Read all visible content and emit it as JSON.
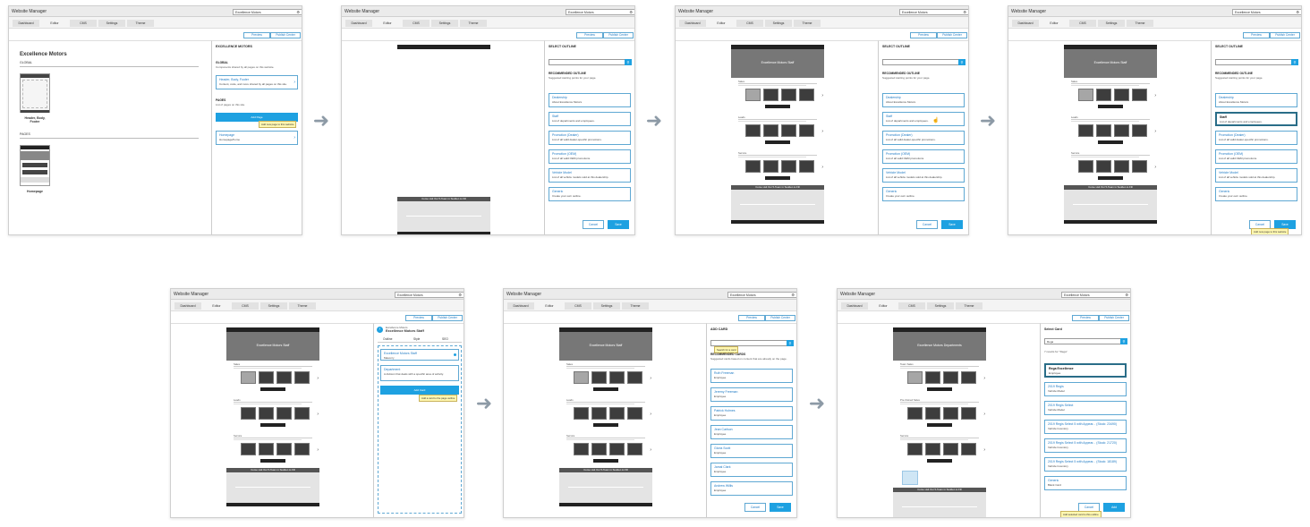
{
  "app": {
    "title": "Website Manager",
    "site": "Excellence Motors",
    "tabs": [
      "Dashboard",
      "Editor",
      "CMS",
      "Settings",
      "Theme"
    ],
    "preview": "Preview",
    "publish": "Publish Center"
  },
  "f1": {
    "panel_title": "EXCELLENCE MOTORS",
    "global_head": "GLOBAL",
    "global_desc": "Components shared by all pages on this website.",
    "hbf_title": "Header, Body, Footer",
    "hbf_desc": "Content, code, and more shared by all pages on this site.",
    "pages_head": "PAGES",
    "pages_desc": "List of pages on this site.",
    "add_page": "Add Page",
    "add_tip": "Add new page to this website",
    "homepage_title": "Homepage",
    "homepage_desc": "Homepage/home",
    "canvas_title": "Excellence Motors",
    "canvas_global": "GLOBAL",
    "canvas_hbf": "Header, Body, Footer",
    "canvas_pages": "PAGES",
    "canvas_home": "Homepage"
  },
  "outline": {
    "title": "SELECT OUTLINE",
    "rec": "RECOMMENDED OUTLINE",
    "rec_desc": "Suggested starting points for your page.",
    "cards": [
      {
        "t": "Dealership",
        "d": "About Excellence Motors"
      },
      {
        "t": "Staff",
        "d": "List of departments and employees."
      },
      {
        "t": "Promotion (Dealer)",
        "d": "List of all valid dealer-specific promotions."
      },
      {
        "t": "Promotion (OEM)",
        "d": "List of all valid OEM promotions."
      },
      {
        "t": "Vehicle Model",
        "d": "List of all vehicle models sold at this dealership."
      },
      {
        "t": "Generic",
        "d": "Create your own outline."
      }
    ],
    "cancel": "Cancel",
    "save": "Save",
    "save_tip": "Add new page to this website"
  },
  "page": {
    "hero": "Excellence Motors Staff",
    "hero2": "Excellence Motors Departments",
    "sections": [
      "Sales",
      "Leads",
      "Service"
    ],
    "sections2": [
      "Team Sales",
      "Pre-Owned Sales",
      "Service"
    ],
    "band": "Come visit Our 5-Team in Sudden to Fill"
  },
  "f5": {
    "crumb": "Excellence Motors",
    "title": "Excellence Motors Staff",
    "tabs": [
      "Outline",
      "Style",
      "SEO"
    ],
    "c1t": "Excellence Motors Staff",
    "c1d": "Masonry",
    "c2t": "Department",
    "c2d": "A division that deals with a specific area of activity.",
    "add_card": "Add Card",
    "tip": "Add a card to the page outline"
  },
  "f6": {
    "title": "ADD CARD",
    "tip": "Search for a card",
    "rec": "RECOMMENDED CARDS",
    "rec_desc": "Suggested cards based on content that are already on the page.",
    "cards": [
      {
        "t": "Ruth Freeman",
        "d": "Employee"
      },
      {
        "t": "Jeremy Freeman",
        "d": "Employee"
      },
      {
        "t": "Patrick Holmes",
        "d": "Employee"
      },
      {
        "t": "Jean Carlson",
        "d": "Employee"
      },
      {
        "t": "Gloria Scott",
        "d": "Employee"
      },
      {
        "t": "Jamal Clark",
        "d": "Employee"
      },
      {
        "t": "Andrew Willis",
        "d": "Employee"
      }
    ],
    "cancel": "Cancel",
    "save": "Save"
  },
  "f7": {
    "title": "Select Card",
    "query": "Rega",
    "results": "7 results for \"Rega\"",
    "cards": [
      {
        "t": "Rega Excellence",
        "d": "Employee"
      },
      {
        "t": "2019 Regis",
        "d": "Vehicle Model"
      },
      {
        "t": "2019 Regis Select",
        "d": "Vehicle Model"
      },
      {
        "t": "2019 Regis Select 5 with Appear... (Stock: 23490)",
        "d": "Vehicle Inventory"
      },
      {
        "t": "2019 Regis Select 5 with Appear... (Stock: 21720)",
        "d": "Vehicle Inventory"
      },
      {
        "t": "2019 Regis Select 5 with Appear... (Stock: 18189)",
        "d": "Vehicle Inventory"
      },
      {
        "t": "Generic",
        "d": "Blank Card"
      }
    ],
    "cancel": "Cancel",
    "add": "Add",
    "tip": "Add selected card to this outline"
  }
}
